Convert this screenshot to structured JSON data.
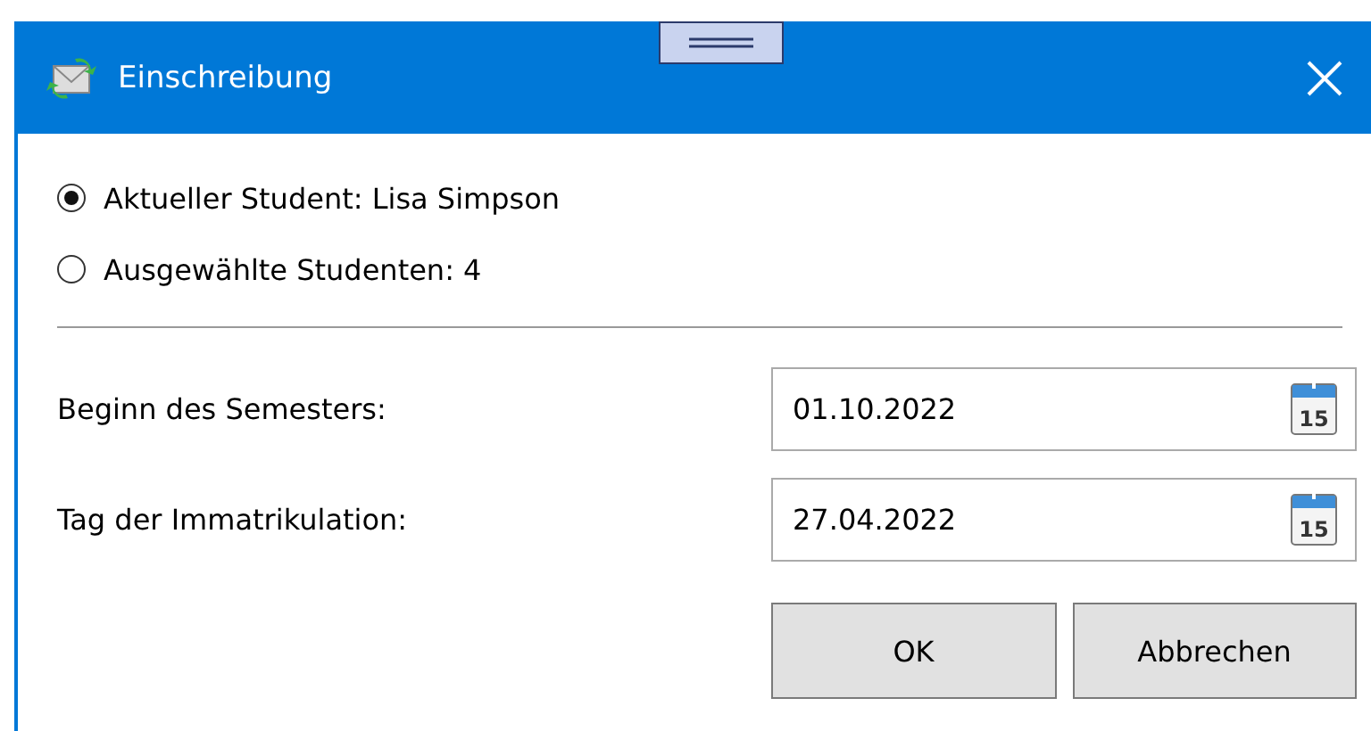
{
  "window": {
    "title": "Einschreibung"
  },
  "options": [
    {
      "label": "Aktueller Student: Lisa Simpson",
      "selected": true
    },
    {
      "label": "Ausgewählte Studenten: 4",
      "selected": false
    }
  ],
  "fields": [
    {
      "label": "Beginn des Semesters:",
      "value": "01.10.2022",
      "calendar_day": "15"
    },
    {
      "label": "Tag der Immatrikulation:",
      "value": "27.04.2022",
      "calendar_day": "15"
    }
  ],
  "buttons": [
    "OK",
    "Abbrechen"
  ]
}
